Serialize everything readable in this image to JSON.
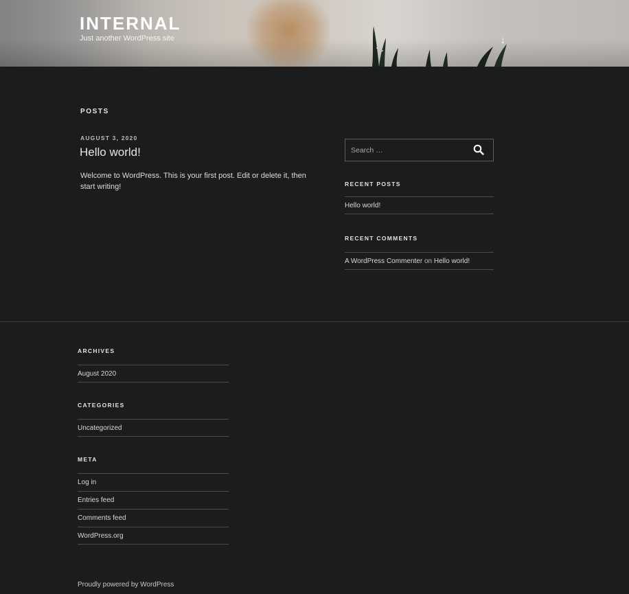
{
  "header": {
    "site_title": "INTERNAL",
    "tagline": "Just another WordPress site",
    "scroll_down_glyph": "↓"
  },
  "main": {
    "page_heading": "POSTS",
    "post": {
      "date": "AUGUST 3, 2020",
      "title": "Hello world!",
      "content": "Welcome to WordPress. This is your first post. Edit or delete it, then start writing!"
    }
  },
  "sidebar": {
    "search": {
      "placeholder": "Search …",
      "icon": "search-icon"
    },
    "recent_posts": {
      "title": "RECENT POSTS",
      "items": [
        "Hello world!"
      ]
    },
    "recent_comments": {
      "title": "RECENT COMMENTS",
      "items": [
        {
          "author": "A WordPress Commenter",
          "connector": "on",
          "post": "Hello world!"
        }
      ]
    }
  },
  "footer": {
    "archives": {
      "title": "ARCHIVES",
      "items": [
        "August 2020"
      ]
    },
    "categories": {
      "title": "CATEGORIES",
      "items": [
        "Uncategorized"
      ]
    },
    "meta": {
      "title": "META",
      "items": [
        "Log in",
        "Entries feed",
        "Comments feed",
        "WordPress.org"
      ]
    },
    "powered_by": "Proudly powered by WordPress"
  },
  "colors": {
    "background": "#1b1c1e",
    "text": "#d6d6d6",
    "divider": "#4a4b4d"
  }
}
